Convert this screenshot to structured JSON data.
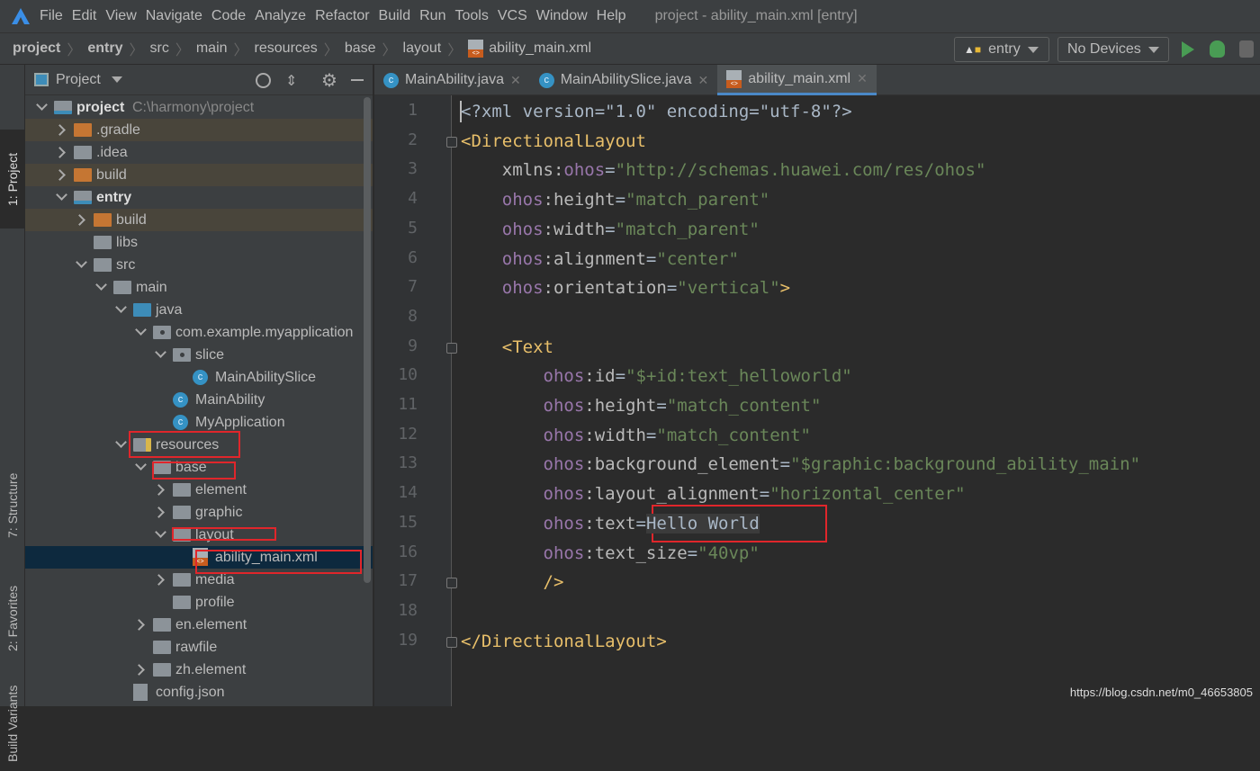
{
  "menubar": {
    "items": [
      "File",
      "Edit",
      "View",
      "Navigate",
      "Code",
      "Analyze",
      "Refactor",
      "Build",
      "Run",
      "Tools",
      "VCS",
      "Window",
      "Help"
    ],
    "title": "project - ability_main.xml [entry]"
  },
  "navbar": {
    "crumbs": [
      "project",
      "entry",
      "src",
      "main",
      "resources",
      "base",
      "layout",
      "ability_main.xml"
    ],
    "run_config": "entry",
    "device": "No Devices"
  },
  "stripe": {
    "tabs": [
      "1: Project",
      "7: Structure",
      "2: Favorites",
      "Build Variants"
    ]
  },
  "project_panel": {
    "title": "Project",
    "root_path": "C:\\harmony\\project",
    "tree": [
      {
        "label": "project",
        "level": 0,
        "arrow": "open",
        "icon": "module",
        "bold": true
      },
      {
        "label": ".gradle",
        "level": 1,
        "arrow": "closed",
        "icon": "orange",
        "ex": true
      },
      {
        "label": ".idea",
        "level": 1,
        "arrow": "closed",
        "icon": "gray"
      },
      {
        "label": "build",
        "level": 1,
        "arrow": "closed",
        "icon": "orange",
        "ex": true
      },
      {
        "label": "entry",
        "level": 1,
        "arrow": "open",
        "icon": "module",
        "bold": true
      },
      {
        "label": "build",
        "level": 2,
        "arrow": "closed",
        "icon": "orange",
        "ex": true
      },
      {
        "label": "libs",
        "level": 2,
        "icon": "gray"
      },
      {
        "label": "src",
        "level": 2,
        "arrow": "open",
        "icon": "gray"
      },
      {
        "label": "main",
        "level": 3,
        "arrow": "open",
        "icon": "gray"
      },
      {
        "label": "java",
        "level": 4,
        "arrow": "open",
        "icon": "blue"
      },
      {
        "label": "com.example.myapplication",
        "level": 5,
        "arrow": "open",
        "icon": "pkg"
      },
      {
        "label": "slice",
        "level": 6,
        "arrow": "open",
        "icon": "pkg"
      },
      {
        "label": "MainAbilitySlice",
        "level": 7,
        "icon": "class"
      },
      {
        "label": "MainAbility",
        "level": 6,
        "icon": "class"
      },
      {
        "label": "MyApplication",
        "level": 6,
        "icon": "class"
      },
      {
        "label": "resources",
        "level": 4,
        "arrow": "open",
        "icon": "res"
      },
      {
        "label": "base",
        "level": 5,
        "arrow": "open",
        "icon": "gray"
      },
      {
        "label": "element",
        "level": 6,
        "arrow": "closed",
        "icon": "gray"
      },
      {
        "label": "graphic",
        "level": 6,
        "arrow": "closed",
        "icon": "gray"
      },
      {
        "label": "layout",
        "level": 6,
        "arrow": "open",
        "icon": "gray"
      },
      {
        "label": "ability_main.xml",
        "level": 7,
        "icon": "xml",
        "selected": true
      },
      {
        "label": "media",
        "level": 6,
        "arrow": "closed",
        "icon": "gray"
      },
      {
        "label": "profile",
        "level": 6,
        "icon": "gray"
      },
      {
        "label": "en.element",
        "level": 5,
        "arrow": "closed",
        "icon": "gray"
      },
      {
        "label": "rawfile",
        "level": 5,
        "icon": "gray"
      },
      {
        "label": "zh.element",
        "level": 5,
        "arrow": "closed",
        "icon": "gray"
      },
      {
        "label": "config.json",
        "level": 4,
        "icon": "json"
      }
    ]
  },
  "editor": {
    "tabs": [
      {
        "label": "MainAbility.java",
        "icon": "class"
      },
      {
        "label": "MainAbilitySlice.java",
        "icon": "class"
      },
      {
        "label": "ability_main.xml",
        "icon": "xml",
        "active": true
      }
    ],
    "lines": [
      [
        [
          "p",
          "<?xml version=\"1.0\" encoding=\"utf-8\"?>"
        ]
      ],
      [
        [
          "tag",
          "<DirectionalLayout"
        ]
      ],
      [
        [
          "p",
          "    "
        ],
        [
          "attr",
          "xmlns:"
        ],
        [
          "ns",
          "ohos"
        ],
        [
          "p",
          "="
        ],
        [
          "val",
          "\"http://schemas.huawei.com/res/ohos\""
        ]
      ],
      [
        [
          "p",
          "    "
        ],
        [
          "ns",
          "ohos"
        ],
        [
          "attr",
          ":height"
        ],
        [
          "p",
          "="
        ],
        [
          "val",
          "\"match_parent\""
        ]
      ],
      [
        [
          "p",
          "    "
        ],
        [
          "ns",
          "ohos"
        ],
        [
          "attr",
          ":width"
        ],
        [
          "p",
          "="
        ],
        [
          "val",
          "\"match_parent\""
        ]
      ],
      [
        [
          "p",
          "    "
        ],
        [
          "ns",
          "ohos"
        ],
        [
          "attr",
          ":alignment"
        ],
        [
          "p",
          "="
        ],
        [
          "val",
          "\"center\""
        ]
      ],
      [
        [
          "p",
          "    "
        ],
        [
          "ns",
          "ohos"
        ],
        [
          "attr",
          ":orientation"
        ],
        [
          "p",
          "="
        ],
        [
          "val",
          "\"vertical\""
        ],
        [
          "tag",
          ">"
        ]
      ],
      [],
      [
        [
          "p",
          "    "
        ],
        [
          "tag",
          "<Text"
        ]
      ],
      [
        [
          "p",
          "        "
        ],
        [
          "ns",
          "ohos"
        ],
        [
          "attr",
          ":id"
        ],
        [
          "p",
          "="
        ],
        [
          "val",
          "\"$+id:text_helloworld\""
        ]
      ],
      [
        [
          "p",
          "        "
        ],
        [
          "ns",
          "ohos"
        ],
        [
          "attr",
          ":height"
        ],
        [
          "p",
          "="
        ],
        [
          "val",
          "\"match_content\""
        ]
      ],
      [
        [
          "p",
          "        "
        ],
        [
          "ns",
          "ohos"
        ],
        [
          "attr",
          ":width"
        ],
        [
          "p",
          "="
        ],
        [
          "val",
          "\"match_content\""
        ]
      ],
      [
        [
          "p",
          "        "
        ],
        [
          "ns",
          "ohos"
        ],
        [
          "attr",
          ":background_element"
        ],
        [
          "p",
          "="
        ],
        [
          "val",
          "\"$graphic:background_ability_main\""
        ]
      ],
      [
        [
          "p",
          "        "
        ],
        [
          "ns",
          "ohos"
        ],
        [
          "attr",
          ":layout_alignment"
        ],
        [
          "p",
          "="
        ],
        [
          "val",
          "\"horizontal_center\""
        ]
      ],
      [
        [
          "p",
          "        "
        ],
        [
          "ns",
          "ohos"
        ],
        [
          "attr",
          ":text"
        ],
        [
          "p",
          "="
        ],
        [
          "plain",
          "Hello World"
        ]
      ],
      [
        [
          "p",
          "        "
        ],
        [
          "ns",
          "ohos"
        ],
        [
          "attr",
          ":text_size"
        ],
        [
          "p",
          "="
        ],
        [
          "val",
          "\"40vp\""
        ]
      ],
      [
        [
          "p",
          "        "
        ],
        [
          "tag",
          "/>"
        ]
      ],
      [],
      [
        [
          "tag",
          "</DirectionalLayout>"
        ]
      ]
    ]
  },
  "watermark": "https://blog.csdn.net/m0_46653805",
  "colors": {
    "accent": "#4a88c7",
    "annotation": "#e0262b",
    "run": "#499c54"
  }
}
